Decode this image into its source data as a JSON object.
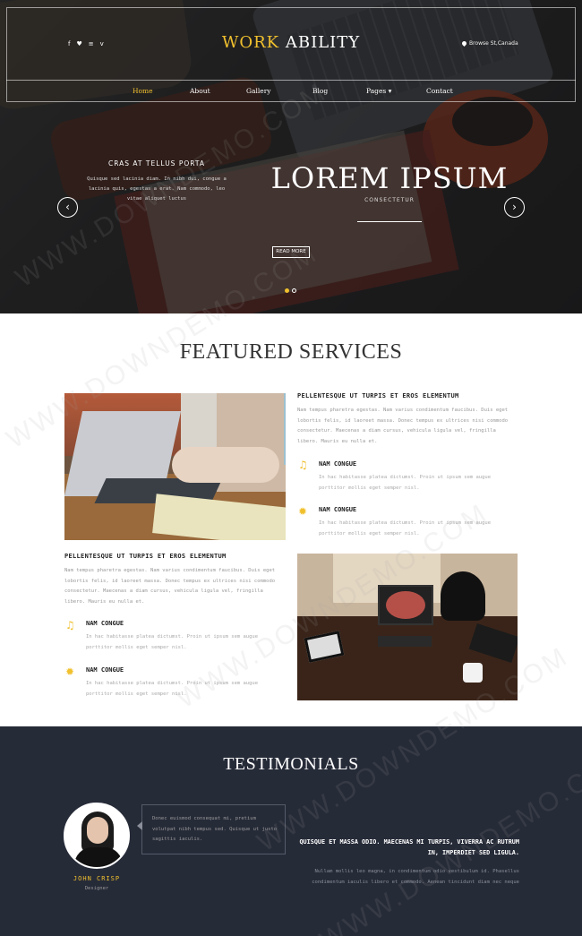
{
  "header": {
    "social_icons": [
      "facebook-icon",
      "twitter-icon",
      "rss-icon",
      "vimeo-icon"
    ],
    "social_glyphs": [
      "f",
      "♥",
      "≡",
      "v"
    ],
    "logo_part1": "WORK",
    "logo_part2": "ABILITY",
    "address": "Browse St,Canada",
    "nav": [
      "Home",
      "About",
      "Gallery",
      "Blog",
      "Pages",
      "Contact"
    ],
    "nav_pages_caret": "▾",
    "active_nav": "Home"
  },
  "hero": {
    "caption_title": "CRAS AT TELLUS PORTA",
    "caption_text": "Quisque sed lacinia diam. In nibh dui, congue a lacinia quis, egestas a erat. Nam commodo, leo vitae aliquet luctus",
    "headline": "LOREM IPSUM",
    "subheadline": "CONSECTETUR",
    "button": "READ MORE",
    "prev_glyph": "‹",
    "next_glyph": "›",
    "slides": 2,
    "active_slide": 1
  },
  "featured": {
    "title": "FEATURED SERVICES",
    "block1": {
      "heading": "PELLENTESQUE UT TURPIS ET EROS ELEMENTUM",
      "paragraph": "Nam tempus pharetra egestas. Nam varius condimentum faucibus. Duis eget lobortis felis, id laoreet massa. Donec tempus ex ultrices nisi commodo consectetur. Maecenas a diam cursus, vehicula ligula vel, fringilla libero. Mauris eu nulla et.",
      "items": [
        {
          "icon": "bell-icon",
          "glyph": "♫",
          "title": "NAM CONGUE",
          "text": "In hac habitasse platea dictumst. Proin ut ipsum sem augue porttitor mollis eget semper nisl."
        },
        {
          "icon": "star-icon",
          "glyph": "✹",
          "title": "NAM CONGUE",
          "text": "In hac habitasse platea dictumst. Proin ut ipsum sem augue porttitor mollis eget semper nisl."
        }
      ]
    },
    "block2": {
      "heading": "PELLENTESQUE UT TURPIS ET EROS ELEMENTUM",
      "paragraph": "Nam tempus pharetra egestas. Nam varius condimentum faucibus. Duis eget lobortis felis, id laoreet massa. Donec tempus ex ultrices nisi commodo consectetur. Maecenas a diam cursus, vehicula ligula vel, fringilla libero. Mauris eu nulla et.",
      "items": [
        {
          "icon": "bell-icon",
          "glyph": "♫",
          "title": "NAM CONGUE",
          "text": "In hac habitasse platea dictumst. Proin ut ipsum sem augue porttitor mollis eget semper nisl."
        },
        {
          "icon": "star-icon",
          "glyph": "✹",
          "title": "NAM CONGUE",
          "text": "In hac habitasse platea dictumst. Proin ut ipsum sem augue porttitor mollis eget semper nisl."
        }
      ]
    }
  },
  "testimonials": {
    "title": "TESTIMONIALS",
    "quote": "Donec euismod consequat mi, pretium volutpat nibh tempus sed. Quisque ut justo sagittis iaculis.",
    "person_name": "JOHN CRISP",
    "person_role": "Designer",
    "heading": "QUISQUE ET MASSA ODIO. MAECENAS MI TURPIS, VIVERRA AC RUTRUM IN, IMPERDIET SED LIGULA.",
    "paragraph": "Nullam mollis leo magna, in condimentum odio vestibulum id. Phasellus condimentum iaculis libero et commodo. Aenean tincidunt diam nec neque"
  },
  "watermark": "WWW.DOWNDEMO.COM",
  "colors": {
    "accent": "#f0c02d",
    "dark": "#262b38"
  }
}
